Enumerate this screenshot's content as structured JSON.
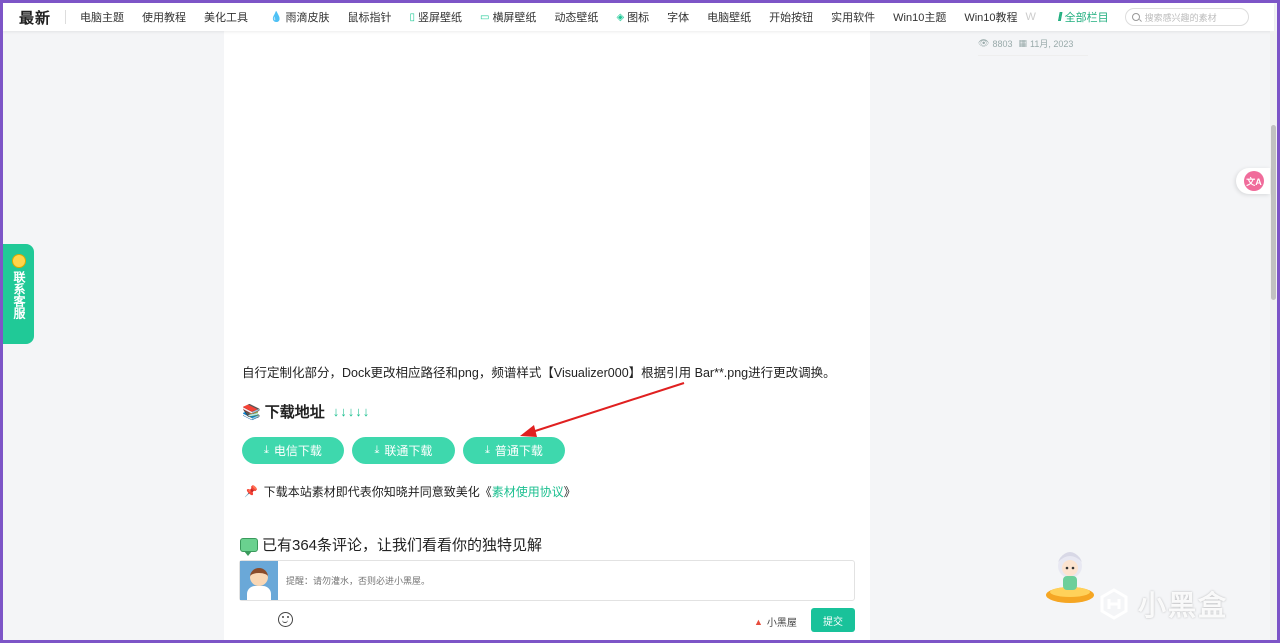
{
  "nav": {
    "logo": "最新",
    "items": [
      {
        "label": "电脑主题",
        "icon": ""
      },
      {
        "label": "使用教程",
        "icon": ""
      },
      {
        "label": "美化工具",
        "icon": ""
      },
      {
        "label": "雨滴皮肤",
        "icon": "drop-icon"
      },
      {
        "label": "鼠标指针",
        "icon": ""
      },
      {
        "label": "竖屏壁纸",
        "icon": "phone-icon"
      },
      {
        "label": "横屏壁纸",
        "icon": "monitor-icon"
      },
      {
        "label": "动态壁纸",
        "icon": ""
      },
      {
        "label": "图标",
        "icon": "layers-icon"
      },
      {
        "label": "字体",
        "icon": ""
      },
      {
        "label": "电脑壁纸",
        "icon": ""
      },
      {
        "label": "开始按钮",
        "icon": ""
      },
      {
        "label": "实用软件",
        "icon": ""
      },
      {
        "label": "Win10主题",
        "icon": ""
      },
      {
        "label": "Win10教程",
        "icon": ""
      }
    ],
    "faded": "W",
    "all_columns": "全部栏目",
    "search_placeholder": "搜索感兴趣的素材"
  },
  "meta": {
    "views": "8803",
    "date": "11月, 2023"
  },
  "article": {
    "description": "自行定制化部分，Dock更改相应路径和png，频谱样式【Visualizer000】根据引用 Bar**.png进行更改调换。",
    "download_title": "下载地址",
    "download_arrows": "↓↓↓↓↓",
    "buttons": [
      "电信下载",
      "联通下载",
      "普通下载"
    ],
    "notice_prefix": "下载本站素材即代表你知晓并同意致美化《",
    "notice_link": "素材使用协议",
    "notice_suffix": "》"
  },
  "comments": {
    "title": "已有364条评论，让我们看看你的独特见解",
    "placeholder": "提醒：请勿灌水，否则必进小黑屋。",
    "black_house": "小黑屋",
    "submit": "提交"
  },
  "contact": {
    "label": "联系客服"
  },
  "translate": {
    "label": "文A"
  },
  "watermark": {
    "text": "小黑盒"
  },
  "colors": {
    "accent": "#20c997",
    "button": "#3ed8ad",
    "frame": "#7d55c7",
    "annotation": "#e02020"
  }
}
